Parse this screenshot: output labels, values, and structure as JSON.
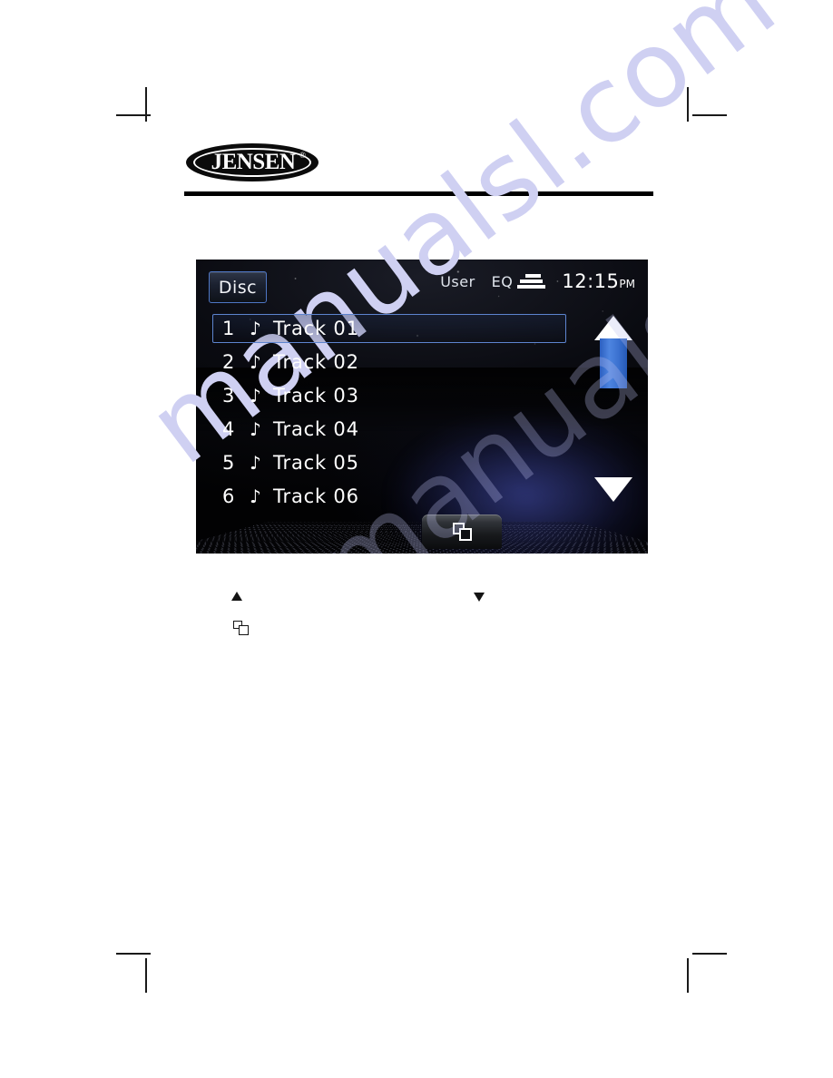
{
  "page": {
    "watermark_text": "manualsl.com"
  },
  "brand": {
    "logo_wordmark": "JENSEN",
    "registered_mark": "®"
  },
  "screen": {
    "status_bar": {
      "source_label": "Disc",
      "user_label": "User",
      "eq_label": "EQ",
      "eq_icon": "equalizer-bars-icon",
      "clock_time": "12:15",
      "clock_meridiem": "PM"
    },
    "track_list": {
      "note_icon": "♪",
      "rows": [
        {
          "number": "1",
          "title": "Track 01",
          "selected": true
        },
        {
          "number": "2",
          "title": "Track 02",
          "selected": false
        },
        {
          "number": "3",
          "title": "Track 03",
          "selected": false
        },
        {
          "number": "4",
          "title": "Track 04",
          "selected": false
        },
        {
          "number": "5",
          "title": "Track 05",
          "selected": false
        },
        {
          "number": "6",
          "title": "Track 06",
          "selected": false
        }
      ]
    },
    "scrollbar": {
      "up_arrow_icon": "triangle-up-icon",
      "down_arrow_icon": "triangle-down-icon",
      "thumb_color": "#3a70cf"
    },
    "list_mode_button": {
      "icon": "overlapping-squares-icon"
    }
  },
  "legend": {
    "up_arrow_icon": "triangle-up-icon",
    "down_arrow_icon": "triangle-down-icon",
    "list_icon": "overlapping-squares-icon"
  },
  "colors": {
    "accent_blue": "#3a70cf",
    "selection_border": "#5d84cf",
    "screen_black": "#010102",
    "watermark": "#cfd0f2"
  }
}
